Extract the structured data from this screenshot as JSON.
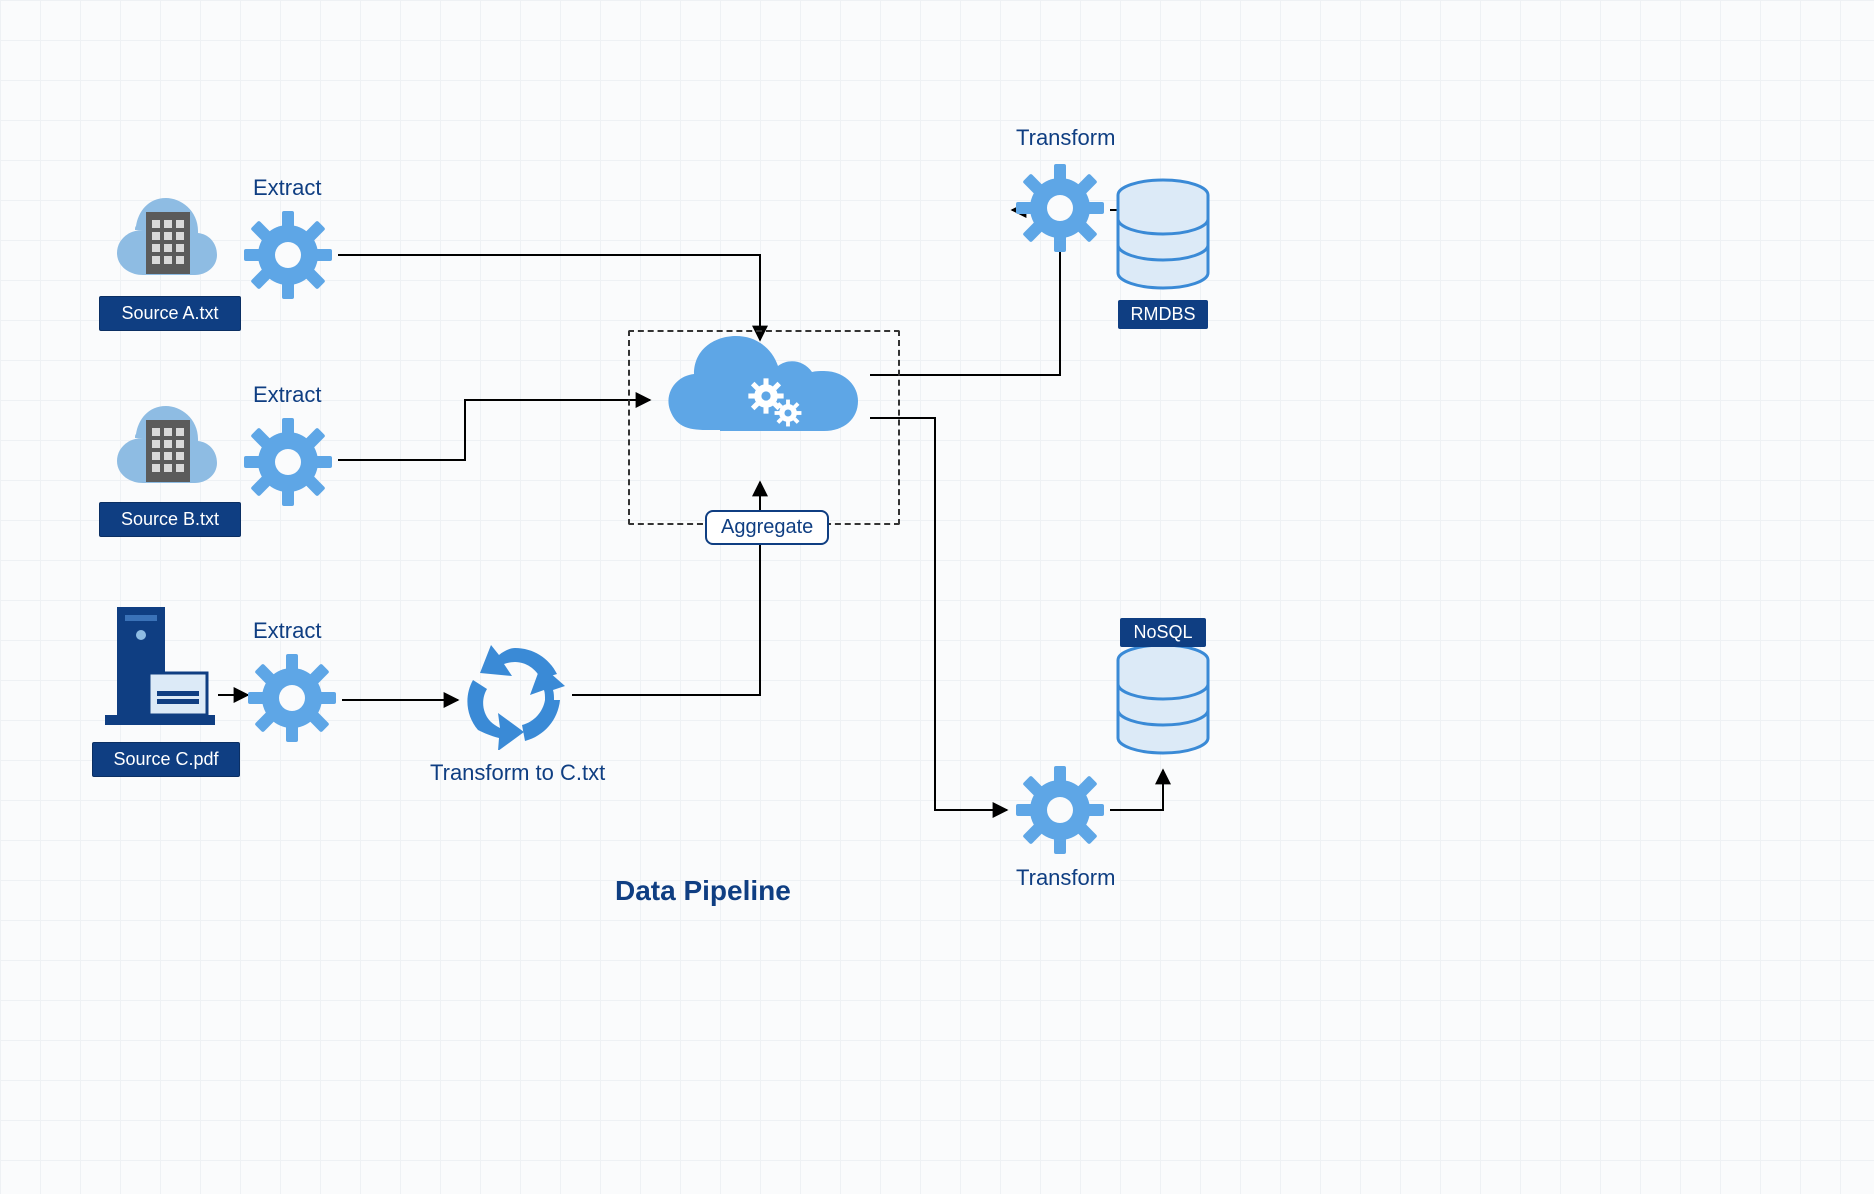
{
  "title": "Data Pipeline",
  "sources": {
    "a": {
      "label": "Source A.txt",
      "extract": "Extract"
    },
    "b": {
      "label": "Source B.txt",
      "extract": "Extract"
    },
    "c": {
      "label": "Source C.pdf",
      "extract": "Extract"
    }
  },
  "transform_c": "Transform to C.txt",
  "aggregate": "Aggregate",
  "transform_top": "Transform",
  "transform_bottom": "Transform",
  "destinations": {
    "rdbms": "RMDBS",
    "nosql": "NoSQL"
  },
  "colors": {
    "brand": "#0f3e82",
    "light_blue": "#5ea6e6",
    "mid_blue": "#3a8ad6",
    "pale_blue": "#dceaf7",
    "grey": "#5b5b5b"
  }
}
